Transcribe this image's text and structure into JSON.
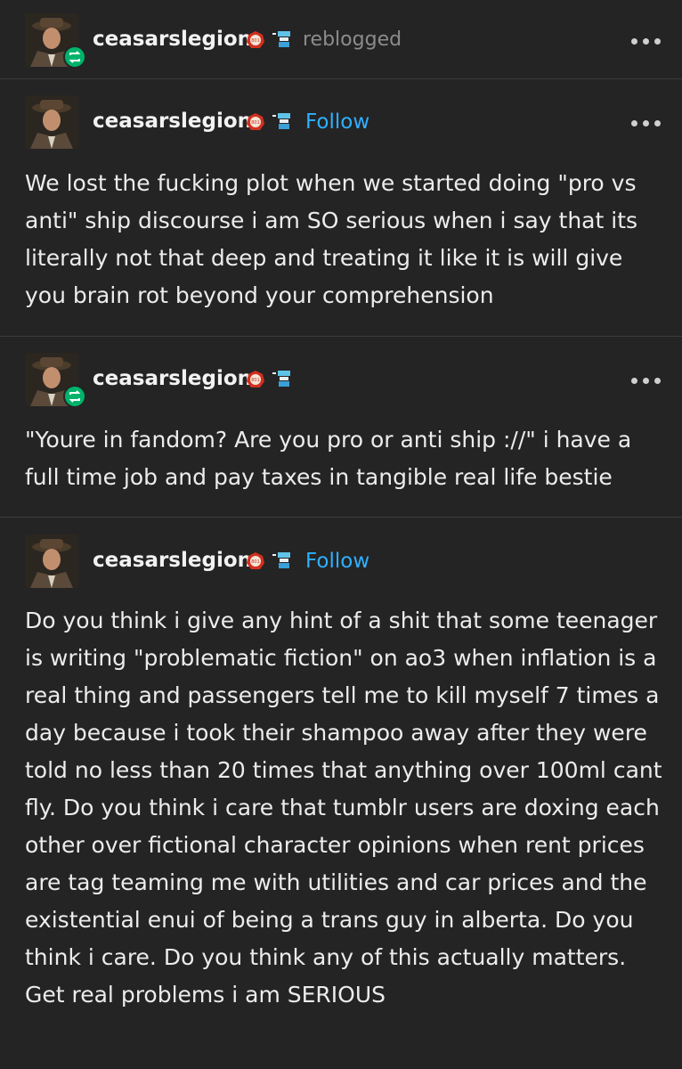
{
  "reblog_header": {
    "username": "ceasarslegion",
    "status": "reblogged",
    "more_icon": "more-horizontal-icon"
  },
  "posts": [
    {
      "username": "ceasarslegion",
      "follow_label": "Follow",
      "text": "We lost the fucking plot when we started doing \"pro vs anti\" ship discourse i am SO serious when i say that its literally not that deep and treating it like it is will give you brain rot beyond your comprehension"
    },
    {
      "username": "ceasarslegion",
      "text": "\"Youre in fandom? Are you pro or anti ship ://\" i have a full time job and pay taxes in tangible real life bestie"
    },
    {
      "username": "ceasarslegion",
      "follow_label": "Follow",
      "text": "Do you think i give any hint of a shit that some teenager is writing \"problematic fiction\" on ao3 when inflation is a real thing and passengers tell me to kill myself 7 times a day because i took their shampoo away after they were told no less than 20 times that anything over 100ml cant fly. Do you think i care that tumblr users are doxing each other over fictional character opinions when rent prices are tag teaming me with utilities and car prices and the existential enui of being a trans guy in alberta. Do you think i care. Do you think any of this actually matters. Get real problems i am SERIOUS"
    }
  ],
  "colors": {
    "background": "#242424",
    "follow": "#2eb0ff",
    "reblog_badge": "#00b36b",
    "muted": "#8c8c8c"
  }
}
